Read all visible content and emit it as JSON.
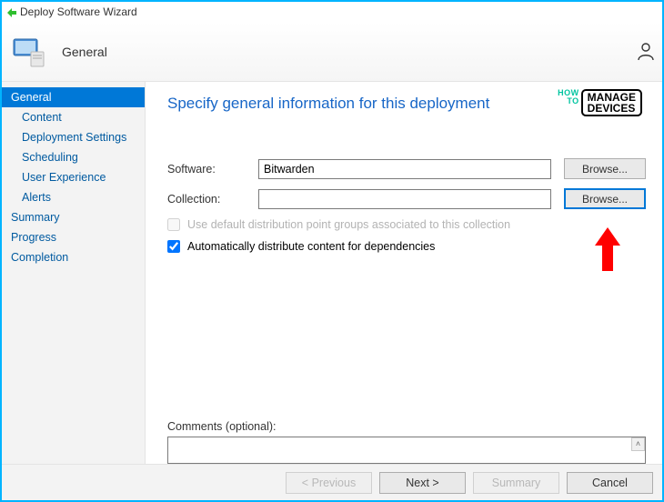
{
  "window": {
    "title": "Deploy Software Wizard"
  },
  "header": {
    "title": "General"
  },
  "sidebar": {
    "general": "General",
    "content": "Content",
    "deployment_settings": "Deployment Settings",
    "scheduling": "Scheduling",
    "user_experience": "User Experience",
    "alerts": "Alerts",
    "summary": "Summary",
    "progress": "Progress",
    "completion": "Completion"
  },
  "main": {
    "heading": "Specify general information for this deployment",
    "software_label": "Software:",
    "software_value": "Bitwarden",
    "software_browse": "Browse...",
    "collection_label": "Collection:",
    "collection_value": "",
    "collection_browse": "Browse...",
    "chk_default_dp": "Use default distribution point groups associated to this collection",
    "chk_auto_dist": "Automatically distribute content for dependencies",
    "comments_label": "Comments (optional):",
    "comments_value": ""
  },
  "footer": {
    "previous": "< Previous",
    "next": "Next >",
    "summary": "Summary",
    "cancel": "Cancel"
  },
  "watermark": {
    "small1": "HOW",
    "small2": "TO",
    "big1": "MANAGE",
    "big2": "DEVICES"
  }
}
